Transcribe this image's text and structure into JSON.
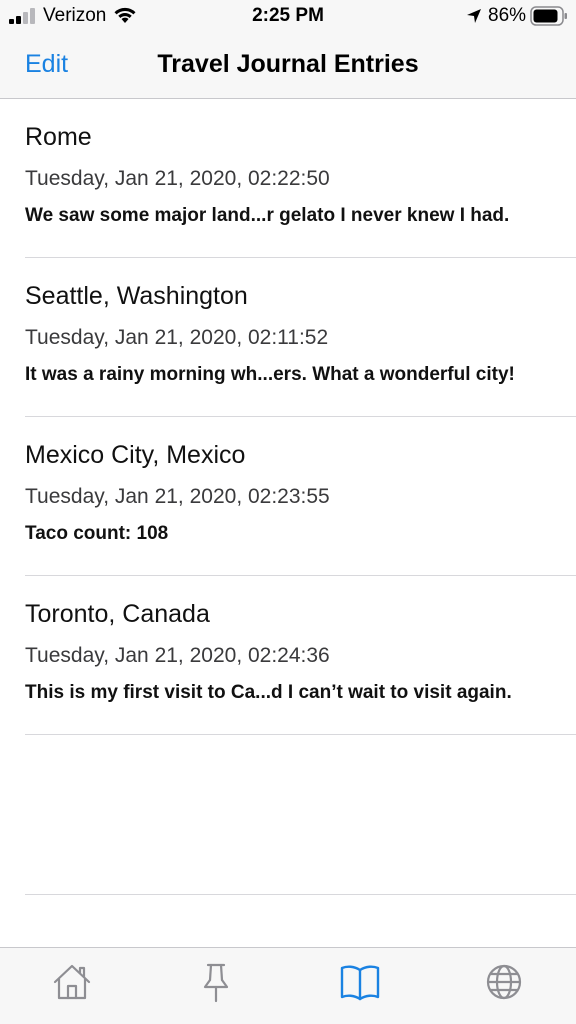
{
  "status_bar": {
    "carrier": "Verizon",
    "time": "2:25 PM",
    "battery": "86%"
  },
  "nav": {
    "edit_label": "Edit",
    "title": "Travel Journal Entries"
  },
  "entries": [
    {
      "title": "Rome",
      "date": "Tuesday, Jan 21, 2020, 02:22:50",
      "snippet": "We saw some major land...r gelato I never knew I had."
    },
    {
      "title": "Seattle, Washington",
      "date": "Tuesday, Jan 21, 2020, 02:11:52",
      "snippet": "It was a rainy morning wh...ers. What a wonderful city!"
    },
    {
      "title": "Mexico City, Mexico",
      "date": "Tuesday, Jan 21, 2020, 02:23:55",
      "snippet": "Taco count: 108"
    },
    {
      "title": "Toronto, Canada",
      "date": "Tuesday, Jan 21, 2020, 02:24:36",
      "snippet": "This is my first visit to Ca...d I can’t wait to visit again."
    }
  ],
  "tabs": [
    {
      "icon": "home-icon",
      "active": false
    },
    {
      "icon": "pushpin-icon",
      "active": false
    },
    {
      "icon": "book-icon",
      "active": true
    },
    {
      "icon": "globe-icon",
      "active": false
    }
  ],
  "colors": {
    "accent": "#1a82e2",
    "inactive_tab": "#8e8e93",
    "bar_background": "#f7f7f7"
  }
}
